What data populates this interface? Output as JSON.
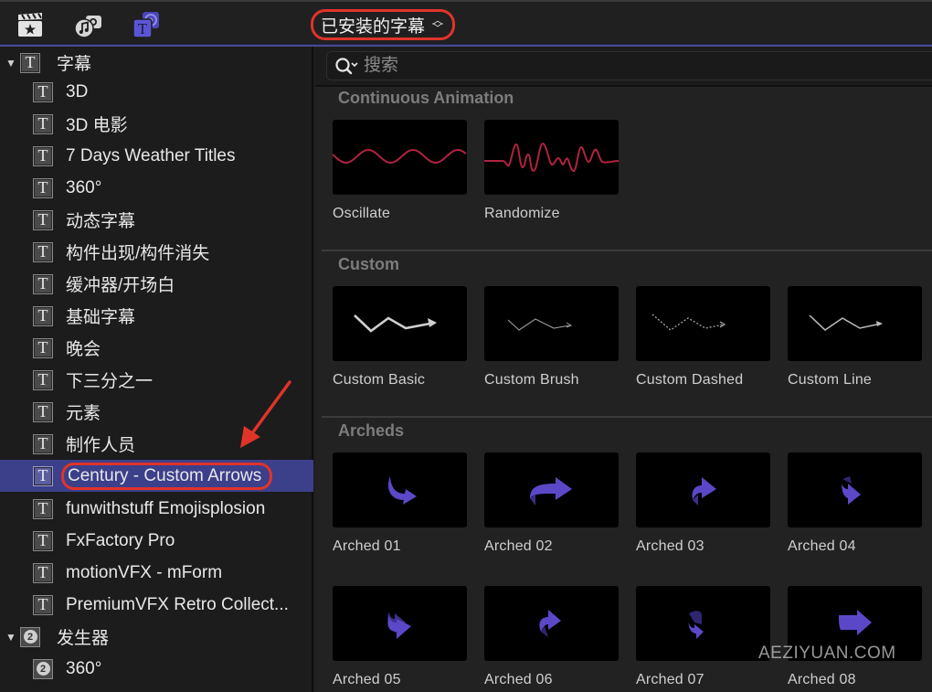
{
  "toolbar": {
    "icons": [
      {
        "name": "clapperboard-star-icon",
        "label": "Libraries"
      },
      {
        "name": "photos-music-icon",
        "label": "Photos and Audio"
      },
      {
        "name": "titles-generators-icon",
        "label": "Titles and Generators"
      }
    ],
    "library_selector": {
      "label": "已安装的字幕",
      "icon": "up-down-chevron-icon"
    }
  },
  "sidebar": {
    "groups": [
      {
        "label": "字幕",
        "icon": "title-T-icon",
        "expanded": true,
        "items": [
          {
            "label": "3D"
          },
          {
            "label": "3D 电影"
          },
          {
            "label": "7 Days Weather Titles"
          },
          {
            "label": "360°"
          },
          {
            "label": "动态字幕"
          },
          {
            "label": "构件出现/构件消失"
          },
          {
            "label": "缓冲器/开场白"
          },
          {
            "label": "基础字幕"
          },
          {
            "label": "晚会"
          },
          {
            "label": "下三分之一"
          },
          {
            "label": "元素"
          },
          {
            "label": "制作人员"
          },
          {
            "label": "Century - Custom Arrows",
            "selected": true
          },
          {
            "label": "funwithstuff Emojisplosion"
          },
          {
            "label": "FxFactory Pro"
          },
          {
            "label": "motionVFX - mForm"
          },
          {
            "label": "PremiumVFX Retro Collect..."
          }
        ]
      },
      {
        "label": "发生器",
        "icon": "generator-2-icon",
        "expanded": true,
        "items": [
          {
            "label": "360°"
          }
        ]
      }
    ]
  },
  "browser": {
    "search": {
      "placeholder": "搜索",
      "value": ""
    },
    "sections": [
      {
        "title": "Continuous Animation",
        "tiles": [
          {
            "label": "Oscillate",
            "thumb": "sine-wave"
          },
          {
            "label": "Randomize",
            "thumb": "random-wave"
          }
        ]
      },
      {
        "title": "Custom",
        "tiles": [
          {
            "label": "Custom Basic",
            "thumb": "zigzag-arrow-bold"
          },
          {
            "label": "Custom Brush",
            "thumb": "zigzag-arrow-thin"
          },
          {
            "label": "Custom Dashed",
            "thumb": "zigzag-arrow-dashed"
          },
          {
            "label": "Custom Line",
            "thumb": "zigzag-arrow-line"
          }
        ]
      },
      {
        "title": "Archeds",
        "tiles": [
          {
            "label": "Arched 01",
            "thumb": "arched-arrow"
          },
          {
            "label": "Arched 02",
            "thumb": "arched-arrow"
          },
          {
            "label": "Arched 03",
            "thumb": "arched-arrow"
          },
          {
            "label": "Arched 04",
            "thumb": "arched-arrow"
          },
          {
            "label": "Arched 05",
            "thumb": "arched-arrow"
          },
          {
            "label": "Arched 06",
            "thumb": "arched-arrow"
          },
          {
            "label": "Arched 07",
            "thumb": "arched-arrow"
          },
          {
            "label": "Arched 08",
            "thumb": "arched-arrow"
          }
        ]
      }
    ]
  },
  "watermark": "AEZIYUAN.COM",
  "colors": {
    "accent": "#5b55d6",
    "selection": "#3c3f8a",
    "annotation_red": "#e0342a",
    "wave": "#b0233f"
  }
}
